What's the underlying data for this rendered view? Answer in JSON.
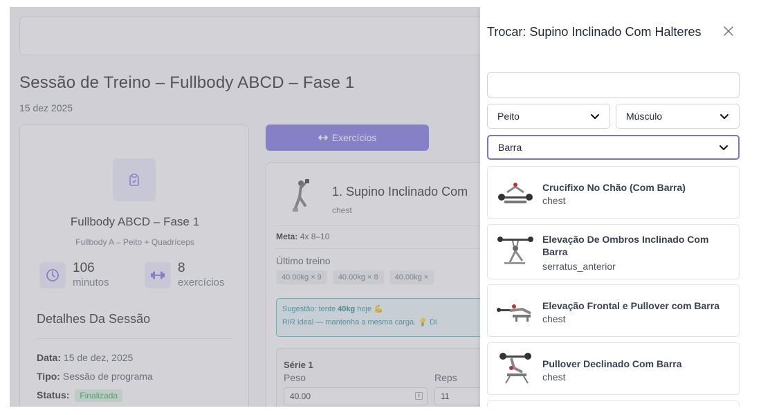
{
  "page": {
    "title": "Sessão de Treino – Fullbody ABCD – Fase 1",
    "date": "15 dez 2025"
  },
  "program_card": {
    "icon": "clipboard-icon",
    "name": "Fullbody ABCD – Fase 1",
    "subtitle": "Fullbody A – Peito + Quadríceps",
    "duration_value": "106",
    "duration_label": "minutos",
    "exercises_value": "8",
    "exercises_label": "exercícios",
    "details_title": "Detalhes Da Sessão",
    "details": [
      {
        "label": "Data:",
        "value": "15 de dez, 2025"
      },
      {
        "label": "Tipo:",
        "value": "Sessão de programa"
      },
      {
        "label": "Status:",
        "value": "Finalizada"
      }
    ]
  },
  "exercises_tab": {
    "label": "Exercícios"
  },
  "exercise_card": {
    "name": "1. Supino Inclinado Com",
    "muscle": "chest",
    "meta_label": "Meta:",
    "meta_value": "4x 8–10",
    "last_label": "Último treino",
    "last_sets": [
      "40.00kg × 9",
      "40.00kg × 8",
      "40.00kg ×"
    ],
    "suggestion_prefix": "Sugestão: tente",
    "suggestion_weight": "40kg",
    "suggestion_suffix": "hoje 💪",
    "suggestion_line2": "RIR ideal — mantenha a mesma carga. 💡 Di",
    "serie_title": "Série 1",
    "weight_label": "Peso",
    "reps_label": "Reps",
    "weight_value": "40.00",
    "reps_value": "11"
  },
  "drawer": {
    "title": "Trocar: Supino Inclinado Com Halteres",
    "search_placeholder": "",
    "filter_group": "Peito",
    "filter_muscle": "Músculo",
    "filter_equipment": "Barra",
    "results": [
      {
        "name": "Crucifixo No Chão (Com Barra)",
        "muscle": "chest"
      },
      {
        "name": "Elevação De Ombros Inclinado Com Barra",
        "muscle": "serratus_anterior"
      },
      {
        "name": "Elevação Frontal e Pullover com Barra",
        "muscle": "chest"
      },
      {
        "name": "Pullover Declinado Com Barra",
        "muscle": "chest"
      }
    ]
  },
  "colors": {
    "accent": "#7b70e3",
    "success_bg": "#d7f3df",
    "success_text": "#2f9e55",
    "info_border": "#46c3cf"
  }
}
